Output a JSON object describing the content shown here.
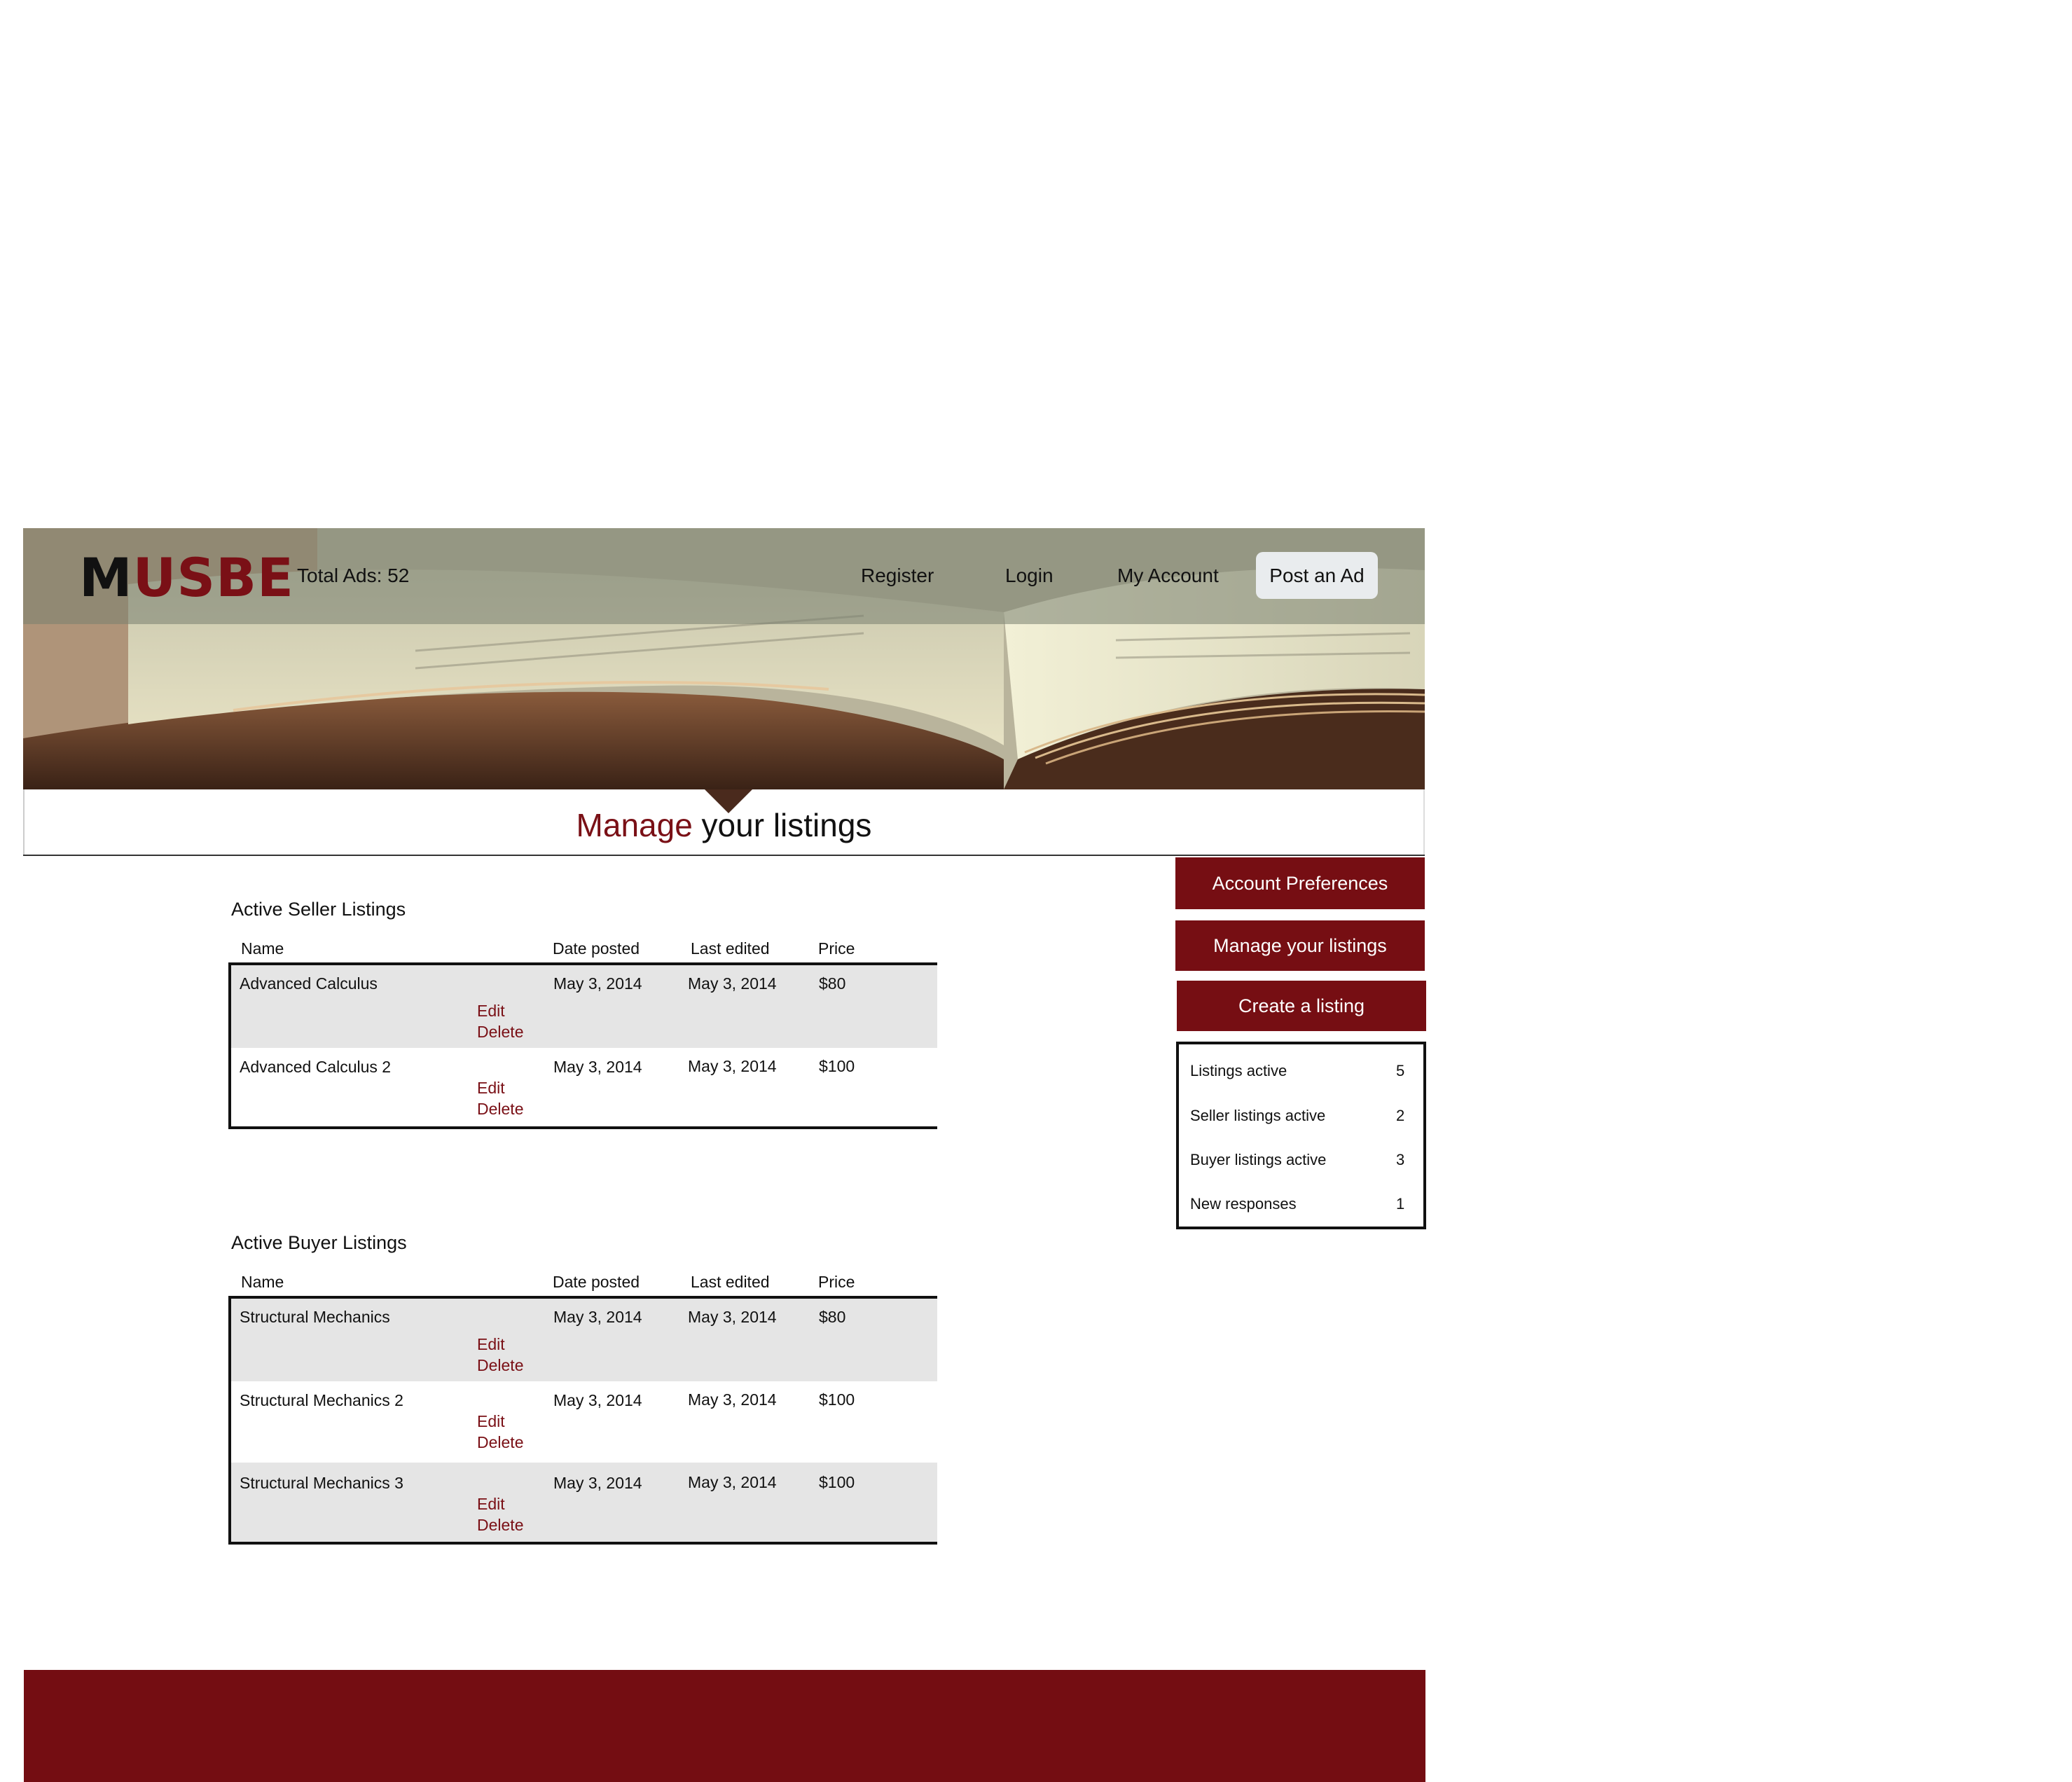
{
  "brand": {
    "logo_first": "M",
    "logo_rest": "USBE",
    "accent_color": "#760e13"
  },
  "header": {
    "total_ads": "Total Ads: 52",
    "nav": {
      "register": "Register",
      "login": "Login",
      "my_account": "My Account"
    },
    "post_ad": "Post an Ad"
  },
  "page_title": {
    "accent": "Manage",
    "rest": " your listings"
  },
  "sidebar": {
    "account_preferences": "Account Preferences",
    "manage_listings": "Manage your listings",
    "create_listing": "Create a listing",
    "stats": [
      {
        "label": "Listings active",
        "value": "5"
      },
      {
        "label": "Seller listings active",
        "value": "2"
      },
      {
        "label": "Buyer listings active",
        "value": "3"
      },
      {
        "label": "New responses",
        "value": "1"
      }
    ]
  },
  "columns": {
    "name": "Name",
    "date_posted": "Date posted",
    "last_edited": "Last edited",
    "price": "Price"
  },
  "actions": {
    "edit": "Edit",
    "delete": "Delete"
  },
  "seller": {
    "title": "Active Seller Listings",
    "rows": [
      {
        "name": "Advanced Calculus",
        "date_posted": "May 3, 2014",
        "last_edited": "May 3, 2014",
        "price": "$80"
      },
      {
        "name": "Advanced Calculus 2",
        "date_posted": "May 3, 2014",
        "last_edited": "May 3, 2014",
        "price": "$100"
      }
    ]
  },
  "buyer": {
    "title": "Active Buyer Listings",
    "rows": [
      {
        "name": "Structural Mechanics",
        "date_posted": "May 3, 2014",
        "last_edited": "May 3, 2014",
        "price": "$80"
      },
      {
        "name": "Structural Mechanics 2",
        "date_posted": "May 3, 2014",
        "last_edited": "May 3, 2014",
        "price": "$100"
      },
      {
        "name": "Structural Mechanics 3",
        "date_posted": "May 3, 2014",
        "last_edited": "May 3, 2014",
        "price": "$100"
      }
    ]
  }
}
